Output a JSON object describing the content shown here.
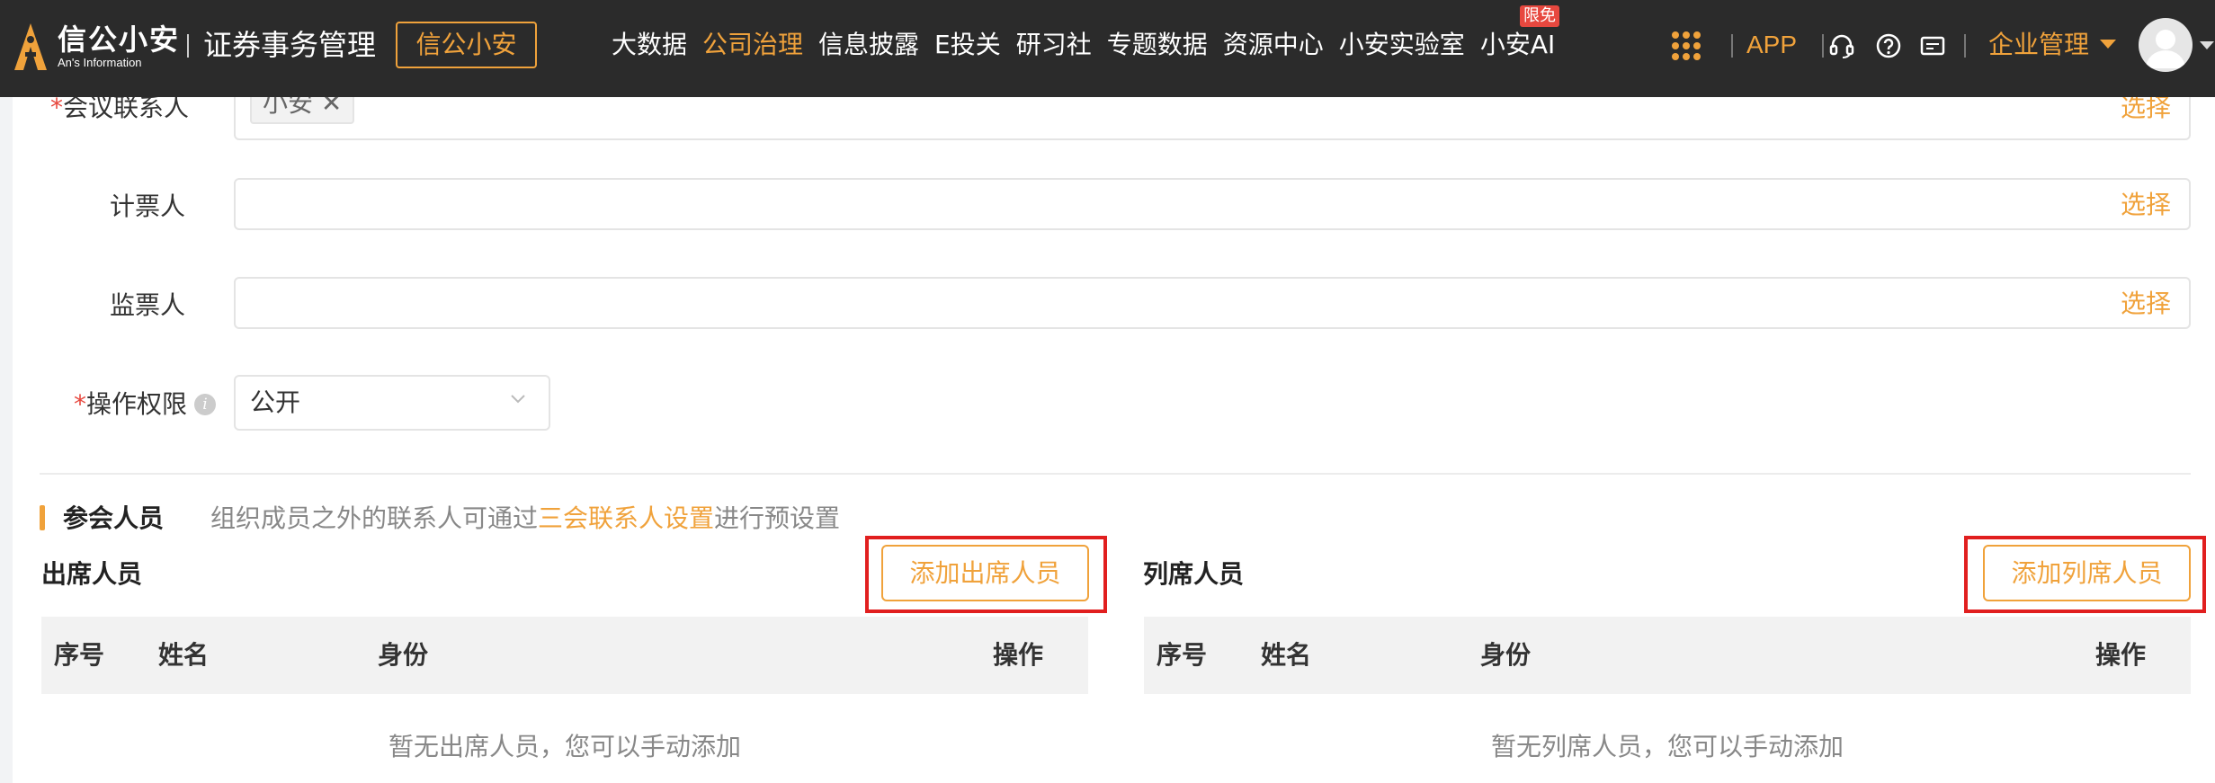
{
  "header": {
    "logo_cn": "信公小安",
    "logo_en": "An's Information",
    "system_title": "证券事务管理",
    "brand_button": "信公小安",
    "nav": [
      "大数据",
      "公司治理",
      "信息披露",
      "E投关",
      "研习社",
      "专题数据",
      "资源中心",
      "小安实验室",
      "小安AI"
    ],
    "nav_active": "公司治理",
    "nav_badge": "限免",
    "app_label": "APP",
    "enterprise_menu": "企业管理",
    "icons": [
      "apps-grid-icon",
      "headset-icon",
      "help-icon",
      "message-icon",
      "avatar"
    ]
  },
  "form": {
    "contact_label": "会议联系人",
    "contact_tag": "小安",
    "contact_select": "选择",
    "counter_label": "计票人",
    "counter_select": "选择",
    "supervisor_label": "监票人",
    "supervisor_select": "选择",
    "permission_label": "操作权限",
    "permission_value": "公开",
    "required_mark": "*",
    "tag_close": "✕",
    "info_mark": "i"
  },
  "attendees": {
    "section_title": "参会人员",
    "hint_prefix": "组织成员之外的联系人可通过",
    "hint_link": "三会联系人设置",
    "hint_suffix": "进行预设置",
    "present": {
      "title": "出席人员",
      "add_button": "添加出席人员",
      "columns": [
        "序号",
        "姓名",
        "身份",
        "操作"
      ],
      "empty_text": "暂无出席人员，您可以手动添加"
    },
    "nonvoting": {
      "title": "列席人员",
      "add_button": "添加列席人员",
      "columns": [
        "序号",
        "姓名",
        "身份",
        "操作"
      ],
      "empty_text": "暂无列席人员，您可以手动添加"
    }
  },
  "colors": {
    "accent": "#f0a23b",
    "header_bg": "#2b2b2b",
    "required": "#e7483f",
    "highlight_box": "#e11f1f"
  }
}
